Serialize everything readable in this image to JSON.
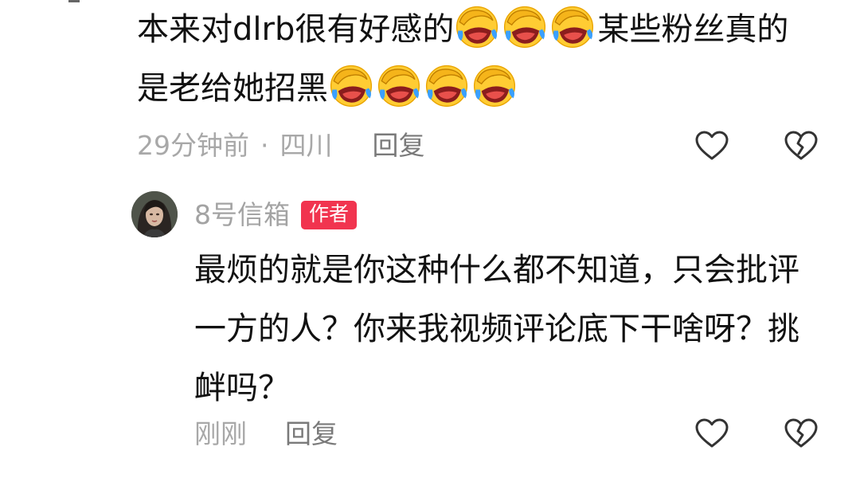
{
  "comments": [
    {
      "text_part1": "本来对dlrb很有好感的",
      "text_part2": "某些粉丝真的",
      "text_part3": "是老给她招黑",
      "emoji_name": "laughing-crying-emoji",
      "time": "29分钟前",
      "separator": "·",
      "location": "四川",
      "reply_label": "回复",
      "like_icon": "heart-outline-icon",
      "dislike_icon": "broken-heart-outline-icon"
    },
    {
      "author": "8号信箱",
      "badge": "作者",
      "line1": "最烦的就是你这种什么都不知道，只会批评",
      "line2": "一方的人？你来我视频评论底下干啥呀？挑",
      "line3": "衅吗？",
      "time": "刚刚",
      "reply_label": "回复",
      "like_icon": "heart-outline-icon",
      "dislike_icon": "broken-heart-outline-icon"
    }
  ],
  "colors": {
    "text": "#111111",
    "meta": "#a8a8a8",
    "badge_bg": "#f1344f",
    "badge_text": "#ffffff",
    "icon": "#333333"
  }
}
